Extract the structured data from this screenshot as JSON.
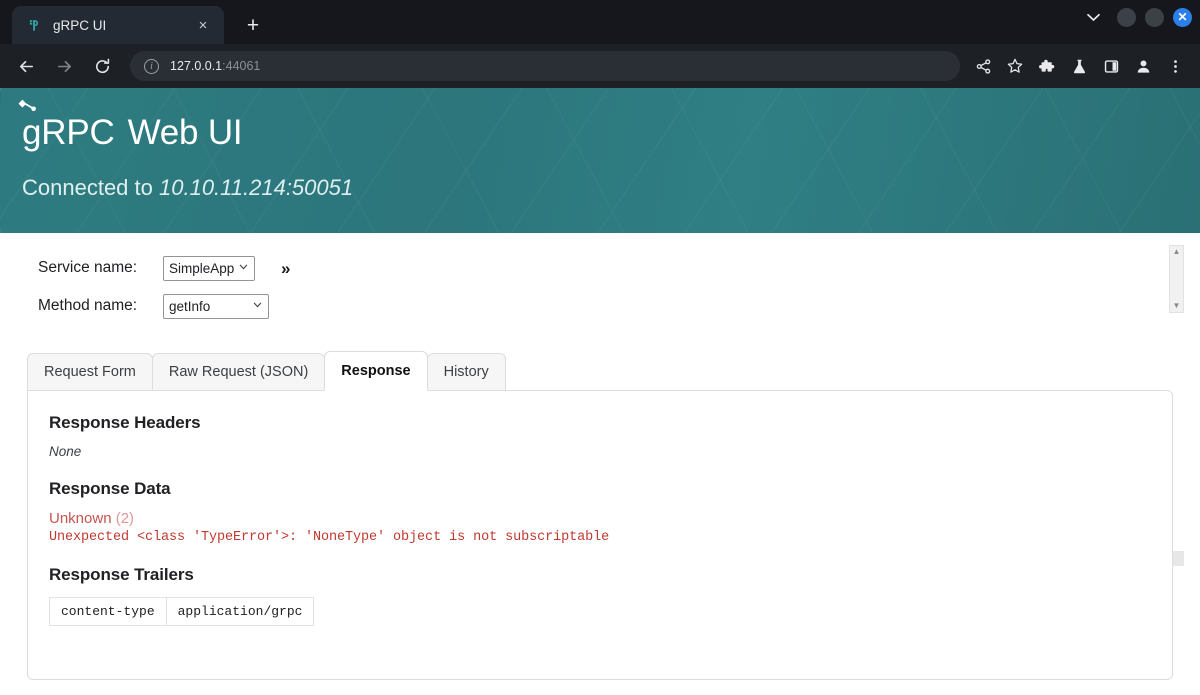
{
  "browser": {
    "tab": {
      "title": "gRPC UI",
      "favicon": "grpc-favicon",
      "close": "×"
    },
    "newtab": "+",
    "window_controls": {
      "chevron": "⌄",
      "minimize": "",
      "maximize": "",
      "close": "✕"
    },
    "nav": {
      "back": "←",
      "forward": "→",
      "reload": "⟳"
    },
    "omnibox": {
      "info": "i",
      "host": "127.0.0.1",
      "port": ":44061"
    },
    "toolbar_icons": [
      "share-icon",
      "bookmark-star-icon",
      "extensions-puzzle-icon",
      "labs-flask-icon",
      "side-panel-icon",
      "profile-icon",
      "more-menu-icon"
    ]
  },
  "hero": {
    "brand_g": "g",
    "brand_rpc": "RPC",
    "brand_web": "Web UI",
    "connected_prefix": "Connected to",
    "connected_target": "10.10.11.214:50051",
    "bg_color": "#2d7b80"
  },
  "selector": {
    "service_label": "Service name:",
    "service_value": "SimpleApp",
    "service_options": [
      "SimpleApp"
    ],
    "method_label": "Method name:",
    "method_value": "getInfo",
    "method_options": [
      "getInfo"
    ],
    "expand_chevron": "»",
    "scroll_up": "▲",
    "scroll_down": "▼",
    "scroll_left": "◀",
    "scroll_right": "▶"
  },
  "tabs": [
    {
      "label": "Request Form",
      "active": false
    },
    {
      "label": "Raw Request (JSON)",
      "active": false
    },
    {
      "label": "Response",
      "active": true
    },
    {
      "label": "History",
      "active": false
    }
  ],
  "response": {
    "headers_title": "Response Headers",
    "headers_value": "None",
    "data_title": "Response Data",
    "error_status": "Unknown",
    "error_code": "(2)",
    "error_message": "Unexpected <class 'TypeError'>: 'NoneType' object is not subscriptable",
    "trailers_title": "Response Trailers",
    "trailers": [
      {
        "key": "content-type",
        "value": "application/grpc"
      }
    ],
    "error_color": "#c75450"
  }
}
